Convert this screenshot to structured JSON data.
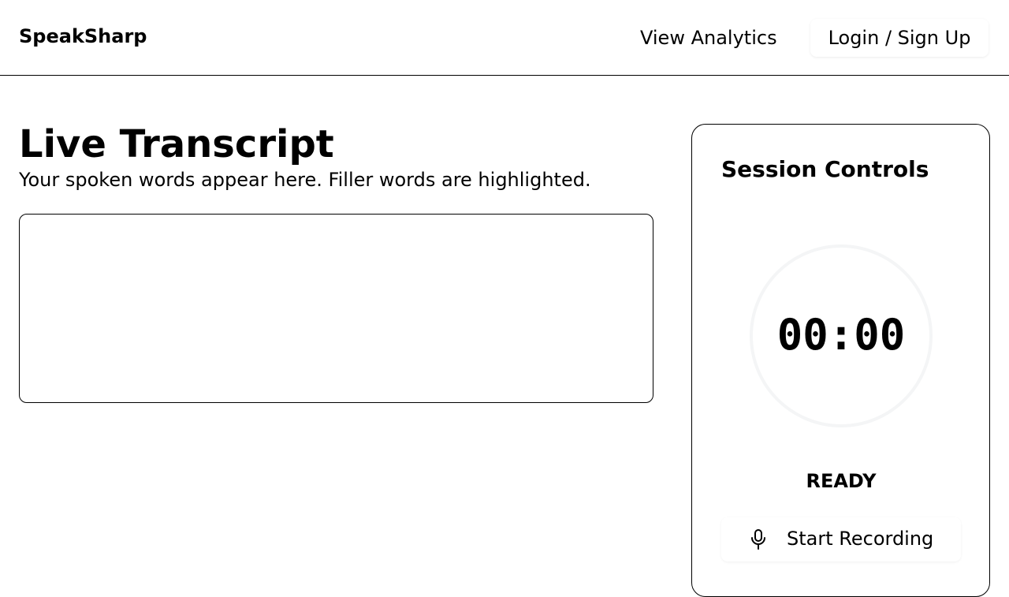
{
  "header": {
    "brand": "SpeakSharp",
    "nav": {
      "analytics_label": "View Analytics",
      "login_label": "Login / Sign Up"
    }
  },
  "transcript": {
    "title": "Live Transcript",
    "subtitle": "Your spoken words appear here. Filler words are highlighted.",
    "content": ""
  },
  "session_controls": {
    "title": "Session Controls",
    "timer": "00:00",
    "status": "READY",
    "start_button": {
      "label": "Start Recording",
      "icon": "microphone-icon"
    }
  },
  "colors": {
    "text": "#000000",
    "background": "#ffffff",
    "timer_ring": "#f4f5f6"
  }
}
